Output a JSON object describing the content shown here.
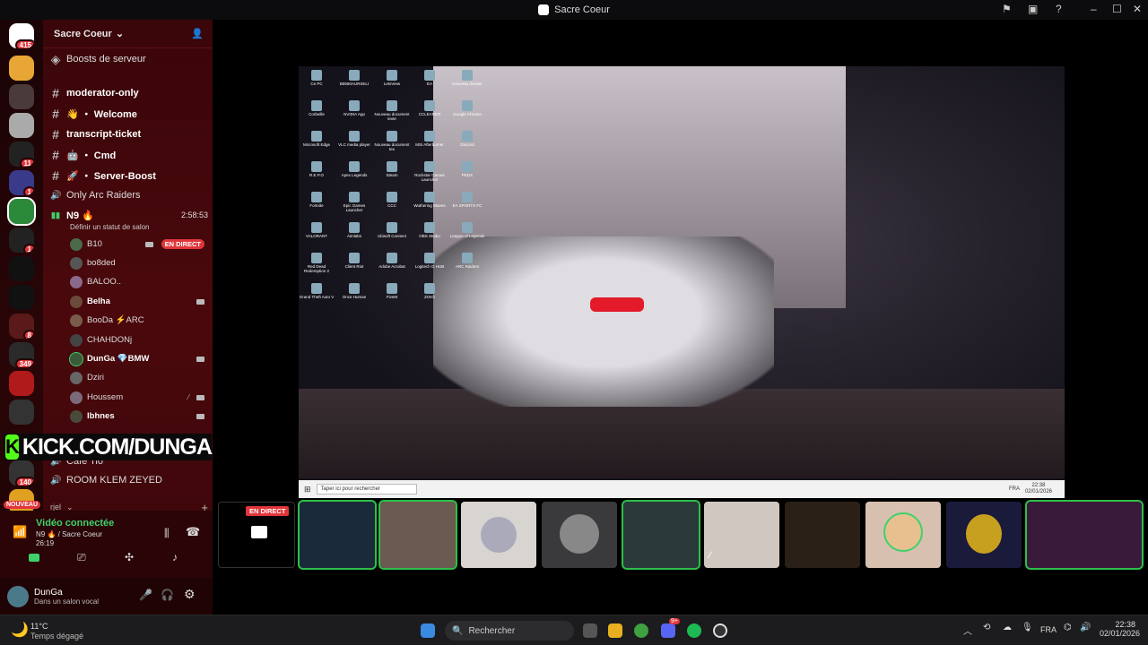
{
  "window": {
    "title": "Sacre Coeur"
  },
  "guild_badges": [
    "415",
    "11",
    "1",
    "1",
    "8",
    "349",
    "140",
    "NOUVEAU"
  ],
  "server": {
    "name": "Sacre Coeur",
    "boosts": "Boosts de serveur"
  },
  "channels": [
    {
      "icon": "#",
      "label": "moderator-only"
    },
    {
      "icon": "#",
      "label": "👋 ・ Welcome"
    },
    {
      "icon": "#",
      "label": "transcript-ticket"
    },
    {
      "icon": "#",
      "label": "🤖 ・ Cmd"
    },
    {
      "icon": "#",
      "label": "🚀 ・ Server-Boost"
    },
    {
      "icon": "🔊",
      "label": "Only Arc Raiders"
    }
  ],
  "voice_channel": {
    "name": "N9 🔥",
    "time": "2:58:53",
    "status": "Définir un statut de salon"
  },
  "voice_users": [
    {
      "name": "B10",
      "live": "EN DIRECT"
    },
    {
      "name": "bo8ded"
    },
    {
      "name": "BALOO.."
    },
    {
      "name": "Belha"
    },
    {
      "name": "BooDa ⚡ARC"
    },
    {
      "name": "CHAHDONj"
    },
    {
      "name": "DunGa 💎BMW"
    },
    {
      "name": "Dziri"
    },
    {
      "name": "Houssem"
    },
    {
      "name": "lbhnes"
    }
  ],
  "kick_overlay": "KICK.COM/DUNGAA",
  "more_channels": [
    {
      "label": "Café Tio"
    },
    {
      "label": "ROOM KLEM ZEYED"
    },
    {
      "label": "rjel"
    }
  ],
  "voice_panel": {
    "title": "Vidéo connectée",
    "channel": "N9 🔥 / Sacre Coeur",
    "time": "26:19"
  },
  "user_panel": {
    "name": "DunGa",
    "status": "Dans un salon vocal"
  },
  "stream_tile_live": "EN DIRECT",
  "desktop": {
    "icons": [
      "Ce PC",
      "B5560AURSELI",
      "LetsView",
      "EA",
      "Nouveau dossier",
      "Corbeille",
      "NVIDIA App",
      "Nouveau document texte",
      "CCLEANER",
      "Google Chrome",
      "Microsoft Edge",
      "VLC media player",
      "Nouveau document tex",
      "MSI Afterburner",
      "Discord",
      "R.E.P.O",
      "Apex Legends",
      "Steam",
      "Rockstar Games Launcher",
      "PEDX",
      "Fortnite",
      "Epic Games Launcher",
      "CCC",
      "Wuthering Waves",
      "EA SPORTS FC",
      "VALORANT",
      "Aimlabs",
      "Ubisoft Connect",
      "OBS Studio",
      "League of Legends",
      "Red Dead Redemption 2",
      "Client Riot",
      "Adobe Acrobat",
      "Logitech G HUB",
      "ARC Raiders",
      "Grand Theft Auto V",
      "Once Human",
      "FiveM",
      "ZIXIO"
    ],
    "search": "Taper ici pour rechercher",
    "clock_time": "22:38",
    "clock_date": "02/01/2026",
    "lang": "FRA"
  },
  "taskbar": {
    "weather_temp": "11°C",
    "weather_desc": "Temps dégagé",
    "search": "Rechercher",
    "lang": "FRA",
    "time": "22:38",
    "date": "02/01/2026",
    "discord_badge": "9+"
  }
}
